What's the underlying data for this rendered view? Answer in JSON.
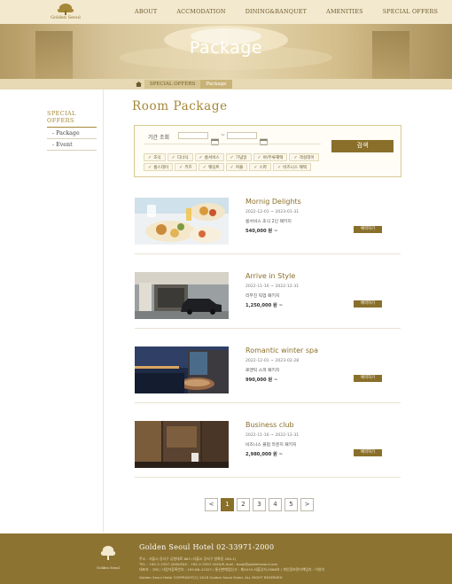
{
  "header": {
    "logo_text": "Golden Seoul",
    "nav": [
      "ABOUT",
      "ACCMODATION",
      "DINING&BANQUET",
      "AMENITIES",
      "SPECIAL OFFERS"
    ]
  },
  "hero": {
    "title": "Package"
  },
  "breadcrumb": {
    "items": [
      "SPECIAL OFFERS",
      "Package"
    ]
  },
  "sidebar": {
    "title": "SPECIAL OFFERS",
    "items": [
      "- Package",
      "- Event"
    ]
  },
  "main": {
    "title": "Room Package"
  },
  "search": {
    "label": "기간 조회",
    "date_separator": "~",
    "button_label": "검색",
    "tags_row1": [
      "조식",
      "디너식",
      "룸서비스",
      "기념일",
      "바/주류혜택",
      "객실데이"
    ],
    "tags_row2": [
      "룸스테이",
      "키즈",
      "웨딩트",
      "커플",
      "스파",
      "비즈니스 혜택"
    ]
  },
  "packages": [
    {
      "title": "Mornig Delights",
      "dates": "2022-12-01 ~ 2023-01-31",
      "desc": "룸서비스 조식 2인 패키지",
      "price": "540,000 원 ~",
      "button": "예약하기"
    },
    {
      "title": "Arrive in Style",
      "dates": "2022-11-16 ~ 2022-12-31",
      "desc": "리무진 픽업 패키지",
      "price": "1,250,000 원 ~",
      "button": "예약하기"
    },
    {
      "title": "Romantic winter spa",
      "dates": "2022-12-01 ~ 2023-02-28",
      "desc": "로맨틱 스파 패키지",
      "price": "990,000 원 ~",
      "button": "예약하기"
    },
    {
      "title": "Business club",
      "dates": "2022-11-16 ~ 2022-12-31",
      "desc": "비즈니스 클럽 라운지 패키지",
      "price": "2,980,000 원 ~",
      "button": "예약하기"
    }
  ],
  "pagination": {
    "prev": "<",
    "next": ">",
    "pages": [
      "1",
      "2",
      "3",
      "4",
      "5"
    ],
    "active": "1"
  },
  "footer": {
    "logo_text": "Golden Seoul",
    "title": "Golden Seoul Hotel 02-33971-2000",
    "address": "주소 : 서울시 강서구 공항대로 663 (서울시 강서구 방화동 280-1)",
    "contact": "TEL : +82-2-3397-2000/FAX : +82-2-3397-2020/E-mail : book@goldenseoul.com",
    "company": "대표자 : 고씨 / 사업자등록번호 : 109-86-41523 / 통신판매업신고 : 제2019-서울강서-0568호 / 개인정보관리책임자 : 이영석",
    "copyright": "Golden Seoul Hotel COPYRIGHT(C) 2018 Golden Seoul Hotel. ALL RIGHT RESERVED"
  },
  "colors": {
    "accent": "#8a6f2a",
    "header_bg": "#f3e9cf",
    "footer_bg": "#8c7332",
    "title_gold": "#a48838"
  }
}
